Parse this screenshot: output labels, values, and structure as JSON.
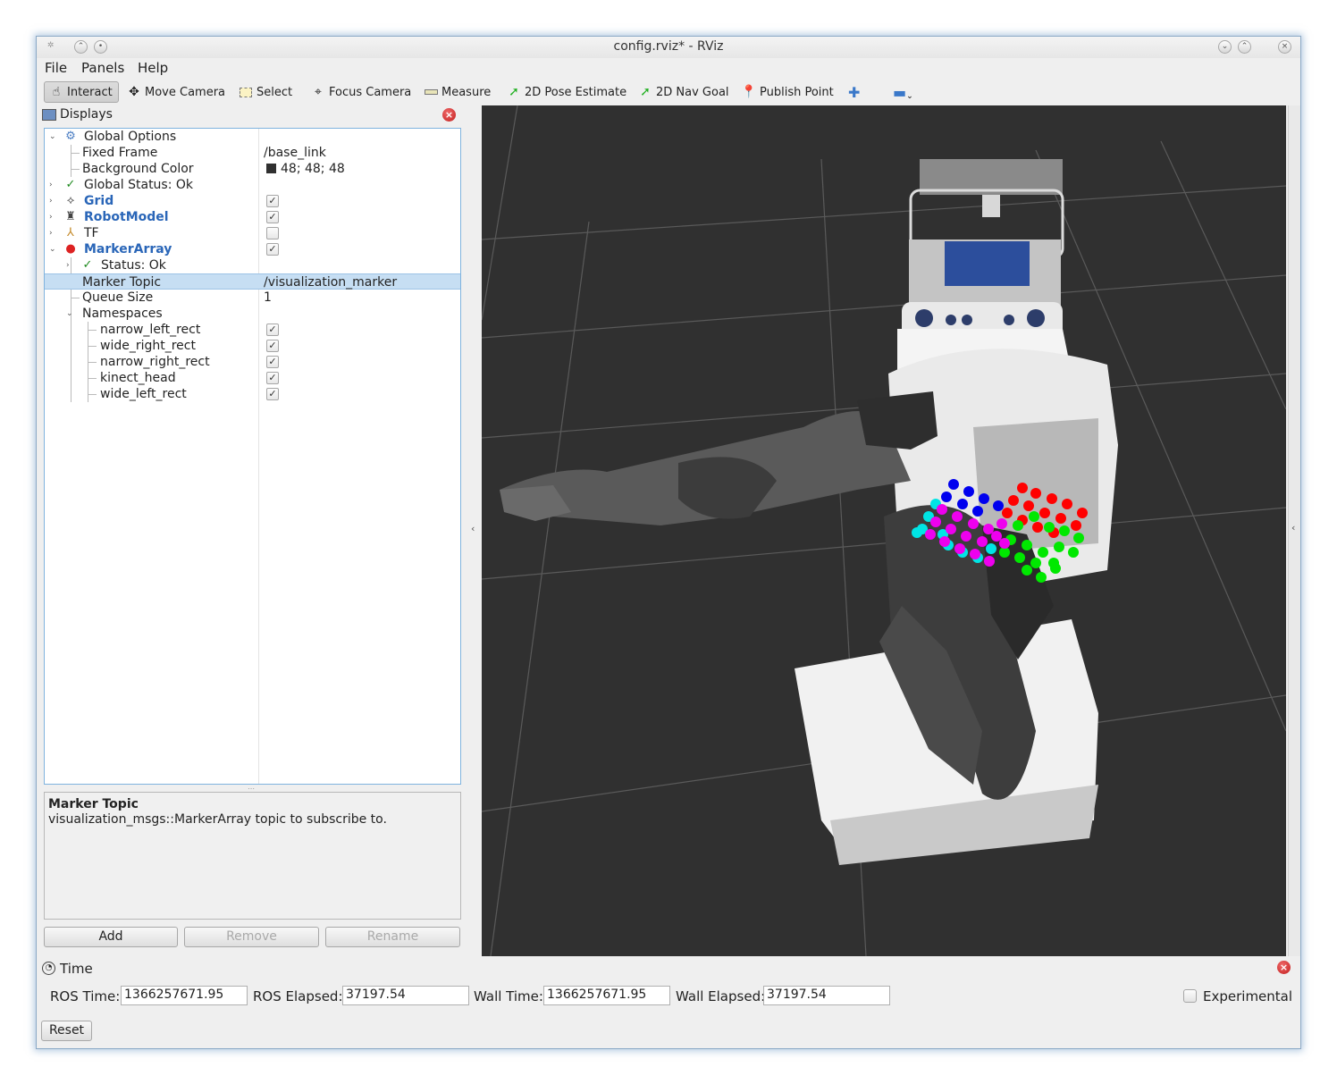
{
  "window": {
    "title": "config.rviz* - RViz"
  },
  "menu": [
    "File",
    "Panels",
    "Help"
  ],
  "toolbar": {
    "interact": "Interact",
    "move_camera": "Move Camera",
    "select": "Select",
    "focus_camera": "Focus Camera",
    "measure": "Measure",
    "pose_estimate": "2D Pose Estimate",
    "nav_goal": "2D Nav Goal",
    "publish_point": "Publish Point"
  },
  "displays": {
    "title": "Displays",
    "rows": [
      {
        "name": "Global Options",
        "value": ""
      },
      {
        "name": "Fixed Frame",
        "value": "/base_link"
      },
      {
        "name": "Background Color",
        "value": "48; 48; 48"
      },
      {
        "name": "Global Status: Ok",
        "value": ""
      },
      {
        "name": "Grid",
        "value": ""
      },
      {
        "name": "RobotModel",
        "value": ""
      },
      {
        "name": "TF",
        "value": ""
      },
      {
        "name": "MarkerArray",
        "value": ""
      },
      {
        "name": "Status: Ok",
        "value": ""
      },
      {
        "name": "Marker Topic",
        "value": "/visualization_marker"
      },
      {
        "name": "Queue Size",
        "value": "1"
      },
      {
        "name": "Namespaces",
        "value": ""
      },
      {
        "name": "narrow_left_rect",
        "value": ""
      },
      {
        "name": "wide_right_rect",
        "value": ""
      },
      {
        "name": "narrow_right_rect",
        "value": ""
      },
      {
        "name": "kinect_head",
        "value": ""
      },
      {
        "name": "wide_left_rect",
        "value": ""
      }
    ]
  },
  "description": {
    "title": "Marker Topic",
    "text": "visualization_msgs::MarkerArray topic to subscribe to."
  },
  "buttons": {
    "add": "Add",
    "remove": "Remove",
    "rename": "Rename",
    "reset": "Reset"
  },
  "time": {
    "title": "Time",
    "ros_time_label": "ROS Time:",
    "ros_time": "1366257671.95",
    "ros_elapsed_label": "ROS Elapsed:",
    "ros_elapsed": "37197.54",
    "wall_time_label": "Wall Time:",
    "wall_time": "1366257671.95",
    "wall_elapsed_label": "Wall Elapsed:",
    "wall_elapsed": "37197.54",
    "experimental": "Experimental"
  },
  "colors": {
    "viewport_bg": "#303030",
    "selection": "#c6def3",
    "link_blue": "#2a66b8"
  }
}
